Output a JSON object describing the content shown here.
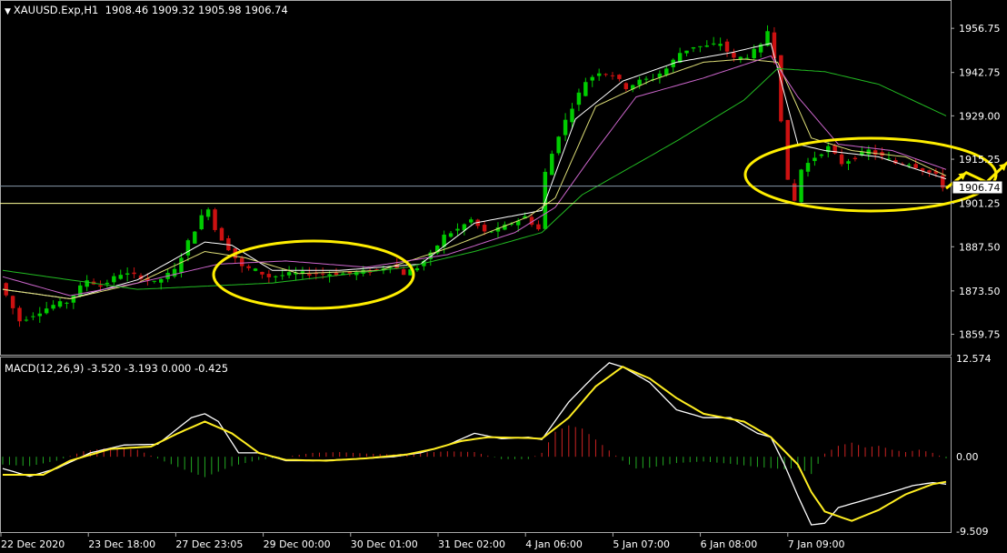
{
  "header": {
    "symbol": "XAUUSD.Exp,H1",
    "ohlc": "1908.46 1909.32 1905.98 1906.74"
  },
  "macd_header": {
    "label": "MACD(12,26,9)",
    "values": "-3.520 -3.193 0.000 -0.425"
  },
  "price_axis": {
    "ticks": [
      "1956.75",
      "1942.75",
      "1929.00",
      "1915.25",
      "1901.25",
      "1887.50",
      "1873.50",
      "1859.75"
    ],
    "current_price": "1906.74"
  },
  "macd_axis": {
    "ticks": [
      "12.574",
      "0.00",
      "-9.509"
    ]
  },
  "time_axis": {
    "ticks": [
      "22 Dec 2020",
      "23 Dec 18:00",
      "27 Dec 23:05",
      "29 Dec 00:00",
      "30 Dec 01:00",
      "31 Dec 02:00",
      "4 Jan 06:00",
      "5 Jan 07:00",
      "6 Jan 08:00",
      "7 Jan 09:00"
    ]
  },
  "colors": {
    "background": "#000000",
    "bull": "#00cc00",
    "bear": "#cc1111",
    "ma_fast": "#ffffff",
    "ma_mid": "#dddd77",
    "ma_slow": "#cc66cc",
    "ma_long": "#22bb22",
    "macd_line": "#ffffff",
    "signal_line": "#ffee22",
    "hist_pos": "#cc2222",
    "hist_neg": "#22aa22",
    "annotation": "#ffee00",
    "hline": "#ffff99"
  },
  "chart_data": [
    {
      "type": "candlestick",
      "title": "XAUUSD.Exp,H1",
      "ylim": [
        1855,
        1964
      ],
      "horizontal_lines": [
        1906.74,
        1901.25
      ],
      "price_path": [
        [
          0,
          1876
        ],
        [
          3,
          1864
        ],
        [
          5,
          1866
        ],
        [
          8,
          1869
        ],
        [
          10,
          1870
        ],
        [
          13,
          1877
        ],
        [
          15,
          1875
        ],
        [
          18,
          1879
        ],
        [
          21,
          1878
        ],
        [
          23,
          1876
        ],
        [
          26,
          1880
        ],
        [
          28,
          1889
        ],
        [
          30,
          1897
        ],
        [
          31,
          1900
        ],
        [
          32,
          1893
        ],
        [
          34,
          1887
        ],
        [
          36,
          1881
        ],
        [
          38,
          1880
        ],
        [
          40,
          1878
        ],
        [
          44,
          1879
        ],
        [
          48,
          1879
        ],
        [
          52,
          1879
        ],
        [
          56,
          1880
        ],
        [
          58,
          1882
        ],
        [
          60,
          1879
        ],
        [
          62,
          1881
        ],
        [
          64,
          1885
        ],
        [
          66,
          1891
        ],
        [
          68,
          1893
        ],
        [
          70,
          1896
        ],
        [
          72,
          1892
        ],
        [
          74,
          1893
        ],
        [
          76,
          1895
        ],
        [
          78,
          1897
        ],
        [
          80,
          1893
        ],
        [
          81,
          1911
        ],
        [
          83,
          1923
        ],
        [
          85,
          1932
        ],
        [
          87,
          1940
        ],
        [
          89,
          1943
        ],
        [
          91,
          1942
        ],
        [
          93,
          1938
        ],
        [
          95,
          1940
        ],
        [
          97,
          1941
        ],
        [
          99,
          1944
        ],
        [
          101,
          1949
        ],
        [
          103,
          1951
        ],
        [
          105,
          1951
        ],
        [
          107,
          1952
        ],
        [
          109,
          1947
        ],
        [
          111,
          1948
        ],
        [
          113,
          1951
        ],
        [
          114,
          1956
        ],
        [
          115,
          1948
        ],
        [
          116,
          1928
        ],
        [
          117,
          1908
        ],
        [
          118,
          1902
        ],
        [
          119,
          1912
        ],
        [
          121,
          1916
        ],
        [
          123,
          1919
        ],
        [
          125,
          1914
        ],
        [
          127,
          1916
        ],
        [
          129,
          1918
        ],
        [
          131,
          1916
        ],
        [
          133,
          1914
        ],
        [
          135,
          1914
        ],
        [
          137,
          1912
        ],
        [
          139,
          1910
        ],
        [
          140,
          1906.74
        ]
      ],
      "moving_averages": [
        {
          "name": "",
          "color": "#ffffff",
          "values": [
            [
              0,
              1874
            ],
            [
              10,
              1871
            ],
            [
              20,
              1877
            ],
            [
              30,
              1889
            ],
            [
              34,
              1888
            ],
            [
              40,
              1880
            ],
            [
              50,
              1880
            ],
            [
              62,
              1882
            ],
            [
              70,
              1895
            ],
            [
              80,
              1899
            ],
            [
              85,
              1928
            ],
            [
              92,
              1940
            ],
            [
              100,
              1946
            ],
            [
              108,
              1949
            ],
            [
              114,
              1952
            ],
            [
              118,
              1920
            ],
            [
              122,
              1918
            ],
            [
              130,
              1916
            ],
            [
              140,
              1909
            ]
          ]
        },
        {
          "name": "",
          "color": "#dddd77",
          "values": [
            [
              0,
              1874
            ],
            [
              10,
              1871
            ],
            [
              20,
              1876
            ],
            [
              30,
              1886
            ],
            [
              36,
              1884
            ],
            [
              44,
              1879
            ],
            [
              56,
              1880
            ],
            [
              66,
              1887
            ],
            [
              78,
              1897
            ],
            [
              82,
              1903
            ],
            [
              88,
              1932
            ],
            [
              96,
              1940
            ],
            [
              104,
              1946
            ],
            [
              110,
              1947
            ],
            [
              115,
              1946
            ],
            [
              120,
              1922
            ],
            [
              126,
              1918
            ],
            [
              134,
              1916
            ],
            [
              140,
              1910
            ]
          ]
        },
        {
          "name": "",
          "color": "#cc66cc",
          "values": [
            [
              0,
              1878
            ],
            [
              10,
              1872
            ],
            [
              20,
              1876
            ],
            [
              32,
              1882
            ],
            [
              42,
              1883
            ],
            [
              54,
              1881
            ],
            [
              66,
              1885
            ],
            [
              76,
              1892
            ],
            [
              82,
              1900
            ],
            [
              88,
              1918
            ],
            [
              94,
              1935
            ],
            [
              104,
              1941
            ],
            [
              114,
              1948
            ],
            [
              118,
              1935
            ],
            [
              124,
              1920
            ],
            [
              132,
              1918
            ],
            [
              140,
              1912
            ]
          ]
        },
        {
          "name": "",
          "color": "#22bb22",
          "values": [
            [
              0,
              1880
            ],
            [
              20,
              1874
            ],
            [
              40,
              1876
            ],
            [
              60,
              1881
            ],
            [
              70,
              1886
            ],
            [
              80,
              1892
            ],
            [
              86,
              1904
            ],
            [
              100,
              1921
            ],
            [
              110,
              1934
            ],
            [
              115,
              1944
            ],
            [
              122,
              1943
            ],
            [
              130,
              1939
            ],
            [
              140,
              1929
            ]
          ]
        }
      ],
      "annotations": {
        "ellipses": 2,
        "projection_path": [
          [
            140,
            1906
          ],
          [
            143,
            1911
          ],
          [
            146,
            1908
          ],
          [
            149,
            1914
          ],
          [
            152,
            1909
          ],
          [
            155,
            1918
          ],
          [
            158,
            1913
          ],
          [
            162,
            1933
          ]
        ]
      }
    },
    {
      "type": "line",
      "title": "MACD(12,26,9)",
      "ylim": [
        -9.509,
        12.574
      ],
      "series": [
        {
          "name": "",
          "values": [
            [
              0,
              -1.5
            ],
            [
              4,
              -2.5
            ],
            [
              8,
              -1.5
            ],
            [
              13,
              0.5
            ],
            [
              18,
              1.5
            ],
            [
              23,
              1.6
            ],
            [
              28,
              5
            ],
            [
              30,
              5.5
            ],
            [
              32,
              4.5
            ],
            [
              35,
              0.5
            ],
            [
              38,
              0.5
            ],
            [
              42,
              -0.5
            ],
            [
              46,
              -0.5
            ],
            [
              52,
              -0.3
            ],
            [
              58,
              0
            ],
            [
              62,
              0.5
            ],
            [
              66,
              1.5
            ],
            [
              70,
              3
            ],
            [
              74,
              2.3
            ],
            [
              78,
              2.5
            ],
            [
              80,
              2.2
            ],
            [
              84,
              7
            ],
            [
              88,
              10.5
            ],
            [
              90,
              12
            ],
            [
              92,
              11.5
            ],
            [
              96,
              9.5
            ],
            [
              100,
              6
            ],
            [
              104,
              5
            ],
            [
              108,
              5
            ],
            [
              112,
              3
            ],
            [
              114,
              2.5
            ],
            [
              116,
              -1
            ],
            [
              118,
              -5
            ],
            [
              120,
              -8.7
            ],
            [
              122,
              -8.5
            ],
            [
              124,
              -6.5
            ],
            [
              128,
              -5.5
            ],
            [
              132,
              -4.5
            ],
            [
              135,
              -3.7
            ],
            [
              138,
              -3.3
            ],
            [
              140,
              -3.5
            ]
          ]
        },
        {
          "name": "",
          "values": [
            [
              0,
              -2.3
            ],
            [
              6,
              -2.3
            ],
            [
              10,
              -0.5
            ],
            [
              16,
              1
            ],
            [
              22,
              1.3
            ],
            [
              26,
              3
            ],
            [
              30,
              4.5
            ],
            [
              34,
              3
            ],
            [
              38,
              0.5
            ],
            [
              42,
              -0.4
            ],
            [
              48,
              -0.5
            ],
            [
              54,
              -0.2
            ],
            [
              60,
              0.3
            ],
            [
              64,
              1
            ],
            [
              68,
              2
            ],
            [
              72,
              2.5
            ],
            [
              78,
              2.4
            ],
            [
              80,
              2.3
            ],
            [
              84,
              5
            ],
            [
              88,
              9
            ],
            [
              92,
              11.5
            ],
            [
              96,
              10
            ],
            [
              100,
              7.5
            ],
            [
              104,
              5.5
            ],
            [
              110,
              4.5
            ],
            [
              114,
              2.5
            ],
            [
              118,
              -1
            ],
            [
              120,
              -4.5
            ],
            [
              122,
              -7
            ],
            [
              126,
              -8.2
            ],
            [
              130,
              -6.8
            ],
            [
              134,
              -4.8
            ],
            [
              138,
              -3.5
            ],
            [
              140,
              -3.2
            ]
          ]
        }
      ],
      "histogram": [
        [
          0,
          -1
        ],
        [
          4,
          -1.2
        ],
        [
          8,
          -0.5
        ],
        [
          12,
          0.7
        ],
        [
          16,
          1.2
        ],
        [
          20,
          0.9
        ],
        [
          24,
          -0.6
        ],
        [
          28,
          -2
        ],
        [
          30,
          -2.6
        ],
        [
          34,
          -1.2
        ],
        [
          38,
          -0.4
        ],
        [
          42,
          0
        ],
        [
          46,
          0.5
        ],
        [
          50,
          0.6
        ],
        [
          54,
          0.4
        ],
        [
          58,
          0.3
        ],
        [
          62,
          0.5
        ],
        [
          66,
          0.7
        ],
        [
          70,
          0.6
        ],
        [
          74,
          -0.3
        ],
        [
          78,
          -0.3
        ],
        [
          80,
          0.5
        ],
        [
          82,
          3.2
        ],
        [
          84,
          4
        ],
        [
          86,
          3.6
        ],
        [
          88,
          2.2
        ],
        [
          90,
          0.8
        ],
        [
          92,
          -0.5
        ],
        [
          94,
          -1.5
        ],
        [
          96,
          -1.4
        ],
        [
          100,
          -0.8
        ],
        [
          104,
          -0.6
        ],
        [
          108,
          -0.9
        ],
        [
          112,
          -1.3
        ],
        [
          116,
          -1.6
        ],
        [
          118,
          -1.4
        ],
        [
          120,
          -2.2
        ],
        [
          122,
          0.4
        ],
        [
          124,
          1.4
        ],
        [
          126,
          1.8
        ],
        [
          128,
          1.2
        ],
        [
          130,
          1.4
        ],
        [
          132,
          0.9
        ],
        [
          134,
          0.6
        ],
        [
          136,
          0.9
        ],
        [
          138,
          0.5
        ],
        [
          140,
          -0.2
        ]
      ]
    }
  ]
}
